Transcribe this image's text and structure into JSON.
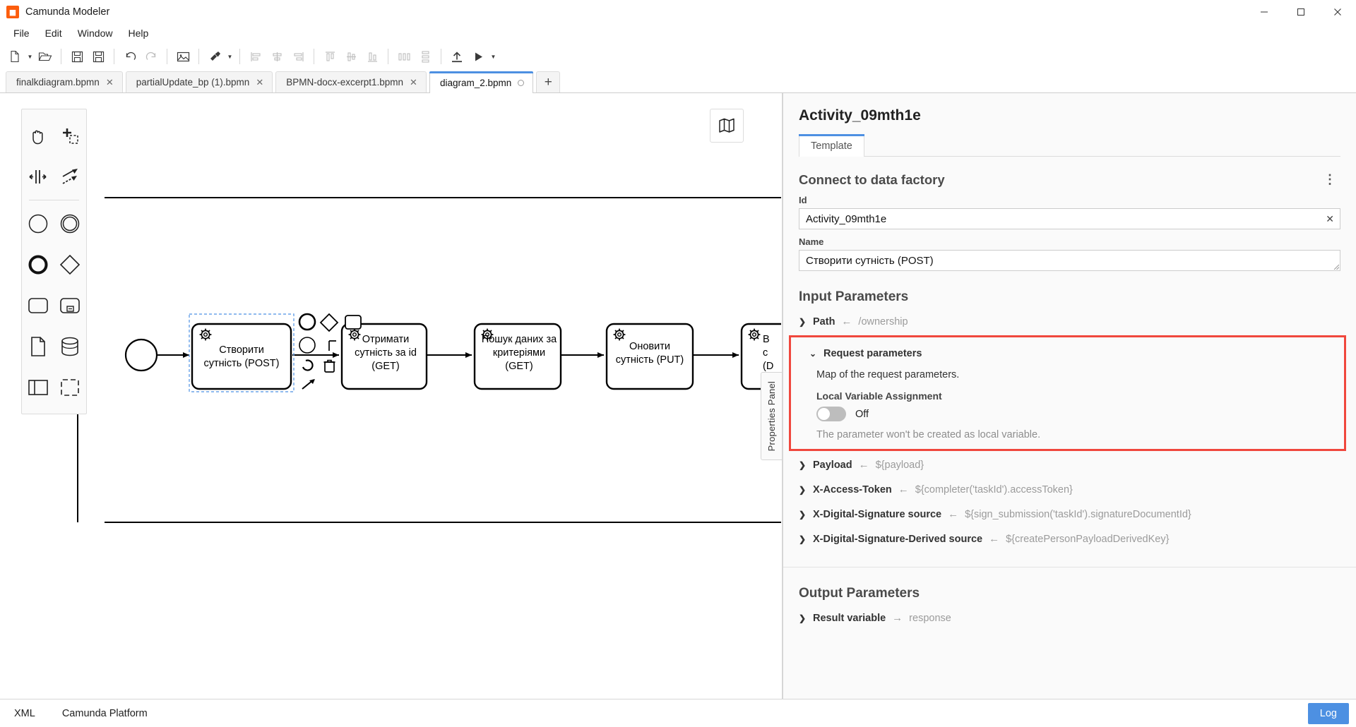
{
  "window": {
    "title": "Camunda Modeler",
    "app_icon": "camunda-icon",
    "minimize_label": "─",
    "maximize_label": "☐",
    "close_label": "✕"
  },
  "menubar": {
    "items": [
      {
        "label": "File"
      },
      {
        "label": "Edit"
      },
      {
        "label": "Window"
      },
      {
        "label": "Help"
      }
    ]
  },
  "toolbar": {
    "buttons": [
      {
        "name": "new-file-button",
        "icon": "new-file-icon",
        "caret": true
      },
      {
        "name": "open-file-button",
        "icon": "open-folder-icon",
        "caret": false
      },
      {
        "name": "save-button",
        "icon": "save-icon",
        "caret": false
      },
      {
        "name": "save-as-button",
        "icon": "save-as-icon",
        "caret": false
      },
      {
        "name": "undo-button",
        "icon": "undo-icon",
        "caret": false
      },
      {
        "name": "redo-button",
        "icon": "redo-icon",
        "caret": false
      },
      {
        "name": "export-image-button",
        "icon": "image-icon",
        "caret": false
      },
      {
        "name": "align-tool-button",
        "icon": "brush-icon",
        "caret": true
      },
      {
        "name": "align-left-button",
        "icon": "align-left-icon",
        "caret": false
      },
      {
        "name": "align-center-button",
        "icon": "align-center-icon",
        "caret": false
      },
      {
        "name": "align-right-button",
        "icon": "align-right-icon",
        "caret": false
      },
      {
        "name": "align-top-button",
        "icon": "align-top-icon",
        "caret": false
      },
      {
        "name": "align-middle-button",
        "icon": "align-middle-icon",
        "caret": false
      },
      {
        "name": "align-bottom-button",
        "icon": "align-bottom-icon",
        "caret": false
      },
      {
        "name": "distribute-horizontal-button",
        "icon": "distribute-horizontal-icon",
        "caret": false
      },
      {
        "name": "distribute-vertical-button",
        "icon": "distribute-vertical-icon",
        "caret": false
      },
      {
        "name": "deploy-button",
        "icon": "deploy-upload-icon",
        "caret": false
      },
      {
        "name": "run-button",
        "icon": "play-icon",
        "caret": true
      }
    ]
  },
  "tabs": {
    "items": [
      {
        "label": "finalkdiagram.bpmn",
        "active": false,
        "dirty": false,
        "close": "✕"
      },
      {
        "label": "partialUpdate_bp (1).bpmn",
        "active": false,
        "dirty": false,
        "close": "✕"
      },
      {
        "label": "BPMN-docx-excerpt1.bpmn",
        "active": false,
        "dirty": false,
        "close": "✕"
      },
      {
        "label": "diagram_2.bpmn",
        "active": true,
        "dirty": true,
        "close": ""
      }
    ],
    "add_label": "+"
  },
  "palette": {
    "tools": [
      {
        "name": "hand-tool",
        "icon": "hand-icon"
      },
      {
        "name": "lasso-tool",
        "icon": "lasso-select-icon"
      },
      {
        "name": "space-tool",
        "icon": "space-tool-icon"
      },
      {
        "name": "connect-tool",
        "icon": "connect-arrows-icon"
      },
      {
        "name": "start-event-tool",
        "icon": "circle-thin-icon"
      },
      {
        "name": "intermediate-event-tool",
        "icon": "double-circle-icon"
      },
      {
        "name": "end-event-tool",
        "icon": "circle-thick-icon"
      },
      {
        "name": "gateway-tool",
        "icon": "diamond-icon"
      },
      {
        "name": "task-tool",
        "icon": "rounded-rect-icon"
      },
      {
        "name": "subprocess-collapsed-tool",
        "icon": "subprocess-icon"
      },
      {
        "name": "data-object-tool",
        "icon": "document-icon"
      },
      {
        "name": "data-store-tool",
        "icon": "database-icon"
      },
      {
        "name": "participant-tool",
        "icon": "pool-icon"
      },
      {
        "name": "group-tool",
        "icon": "group-dashed-icon"
      }
    ]
  },
  "canvas": {
    "minimap_icon": "map-icon",
    "properties_tab_label": "Properties Panel",
    "tasks": [
      {
        "label": "Створити\nсутність (POST)",
        "selected": true
      },
      {
        "label": "Отримати\nсутність за id\n(GET)",
        "selected": false
      },
      {
        "label": "Пошук даних за\nкритеріями\n(GET)",
        "selected": false
      },
      {
        "label": "Оновити\nсутність (PUT)",
        "selected": false
      },
      {
        "label": "B\nс\n(D",
        "selected": false
      }
    ],
    "context_pad": [
      {
        "name": "append-end-event",
        "icon": "circle-thick-icon"
      },
      {
        "name": "append-gateway",
        "icon": "diamond-icon"
      },
      {
        "name": "append-task",
        "icon": "rounded-rect-icon"
      },
      {
        "name": "append-intermediate-event",
        "icon": "circle-thin-icon"
      },
      {
        "name": "append-text-annotation",
        "icon": "annotation-icon"
      },
      {
        "name": "replace-element",
        "icon": "wrench-icon"
      },
      {
        "name": "delete-element",
        "icon": "trash-icon"
      },
      {
        "name": "connect-element",
        "icon": "connect-arrow-icon"
      }
    ]
  },
  "properties": {
    "title": "Activity_09mth1e",
    "tabs": [
      {
        "label": "Template",
        "active": true
      }
    ],
    "group": {
      "title": "Connect to data factory",
      "menu_icon": "kebab-menu-icon"
    },
    "id_field": {
      "label": "Id",
      "value": "Activity_09mth1e",
      "clear_icon": "✕"
    },
    "name_field": {
      "label": "Name",
      "value": "Створити сутність (POST)"
    },
    "input_parameters": {
      "title": "Input Parameters",
      "rows_before": [
        {
          "chevron": "❯",
          "name": "Path",
          "arrow": "←",
          "value": "/ownership",
          "expanded": false
        }
      ],
      "highlighted": {
        "chevron": "⌄",
        "name": "Request parameters",
        "description": "Map of the request parameters.",
        "sub_label": "Local Variable Assignment",
        "toggle_state": "Off",
        "toggle_on": false,
        "note": "The parameter won't be created as local variable.",
        "border_color": "#f0473d"
      },
      "rows_after": [
        {
          "chevron": "❯",
          "name": "Payload",
          "arrow": "←",
          "value": "${payload}",
          "expanded": false
        },
        {
          "chevron": "❯",
          "name": "X-Access-Token",
          "arrow": "←",
          "value": "${completer('taskId').accessToken}",
          "expanded": false
        },
        {
          "chevron": "❯",
          "name": "X-Digital-Signature source",
          "arrow": "←",
          "value": "${sign_submission('taskId').signatureDocumentId}",
          "expanded": false
        },
        {
          "chevron": "❯",
          "name": "X-Digital-Signature-Derived source",
          "arrow": "←",
          "value": "${createPersonPayloadDerivedKey}",
          "expanded": false
        }
      ]
    },
    "output_parameters": {
      "title": "Output Parameters",
      "rows": [
        {
          "chevron": "❯",
          "name": "Result variable",
          "arrow": "→",
          "value": "response",
          "expanded": false
        }
      ]
    }
  },
  "statusbar": {
    "items": [
      {
        "label": "XML"
      },
      {
        "label": "Camunda Platform"
      }
    ],
    "log_label": "Log",
    "accent": "#4d90e2"
  }
}
